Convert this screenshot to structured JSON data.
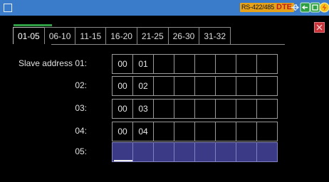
{
  "status_bar": {
    "interface_badge": "RS-422/485",
    "mode_badge": "DTE",
    "icons": [
      "menu-icon",
      "usb-icon",
      "network-icon",
      "screen-icon",
      "battery-charging-icon"
    ]
  },
  "tabs": [
    "01-05",
    "06-10",
    "11-15",
    "16-20",
    "21-25",
    "26-30",
    "31-32"
  ],
  "active_tab": "01-05",
  "rows": [
    {
      "label": "Slave address 01:",
      "values": [
        "00",
        "01",
        "",
        "",
        "",
        "",
        "",
        ""
      ]
    },
    {
      "label": "02:",
      "values": [
        "00",
        "02",
        "",
        "",
        "",
        "",
        "",
        ""
      ]
    },
    {
      "label": "03:",
      "values": [
        "00",
        "03",
        "",
        "",
        "",
        "",
        "",
        ""
      ]
    },
    {
      "label": "04:",
      "values": [
        "00",
        "04",
        "",
        "",
        "",
        "",
        "",
        ""
      ]
    },
    {
      "label": "05:",
      "values": [
        "",
        "",
        "",
        "",
        "",
        "",
        "",
        ""
      ],
      "editing": true
    }
  ],
  "colors": {
    "status_bar": "#3a7cc9",
    "accent": "#e6a31a",
    "active_tab_indicator": "#2ea043",
    "close": "#c9343a",
    "editing_row": "#3a3a86"
  }
}
